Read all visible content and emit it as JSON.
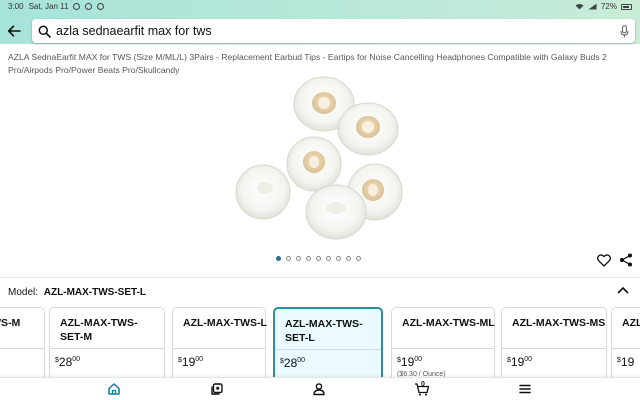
{
  "status_bar": {
    "time": "3:00",
    "date": "Sat, Jan 11",
    "battery": "72%"
  },
  "search": {
    "query": "azla sednaearfit max for tws"
  },
  "product": {
    "title": "AZLA SednaEarfit MAX for TWS (Size M/ML/L) 3Pairs - Replacement Earbud Tips - Eartips for Noise Cancelling Headphones Compatible with Galaxy Buds 2 Pro/Airpods Pro/Power Beats Pro/Skullcandy",
    "image_count": 9,
    "active_image": 1
  },
  "model": {
    "label": "Model:",
    "value": "AZL-MAX-TWS-SET-L"
  },
  "variants": [
    {
      "name": "AZL-MAX-TWS-M",
      "price_whole": "",
      "price_frac": "",
      "unit": "",
      "selected": false
    },
    {
      "name": "AZL-MAX-TWS-SET-M",
      "price_whole": "28",
      "price_frac": "00",
      "unit": "",
      "selected": false
    },
    {
      "name": "AZL-MAX-TWS-L",
      "price_whole": "19",
      "price_frac": "00",
      "unit": "",
      "selected": false
    },
    {
      "name": "AZL-MAX-TWS-SET-L",
      "price_whole": "28",
      "price_frac": "00",
      "unit": "",
      "selected": true
    },
    {
      "name": "AZL-MAX-TWS-ML",
      "price_whole": "19",
      "price_frac": "00",
      "unit": "($6.30 / Ounce)",
      "selected": false
    },
    {
      "name": "AZL-MAX-TWS-MS",
      "price_whole": "19",
      "price_frac": "00",
      "unit": "",
      "selected": false
    },
    {
      "name": "AZL-",
      "price_whole": "19",
      "price_frac": "",
      "unit": "",
      "selected": false
    }
  ],
  "currency": "$",
  "colors": {
    "accent": "#2a8fa0",
    "nav_active": "#0a7fa0",
    "dot_active": "#2f6f9f"
  },
  "icons": {
    "back": "arrow-left",
    "search": "magnifier",
    "mic": "microphone",
    "wishlist": "heart",
    "share": "share",
    "collapse": "chevron-up",
    "nav": [
      "home",
      "you",
      "account",
      "cart",
      "menu"
    ]
  },
  "cart_count": "0"
}
